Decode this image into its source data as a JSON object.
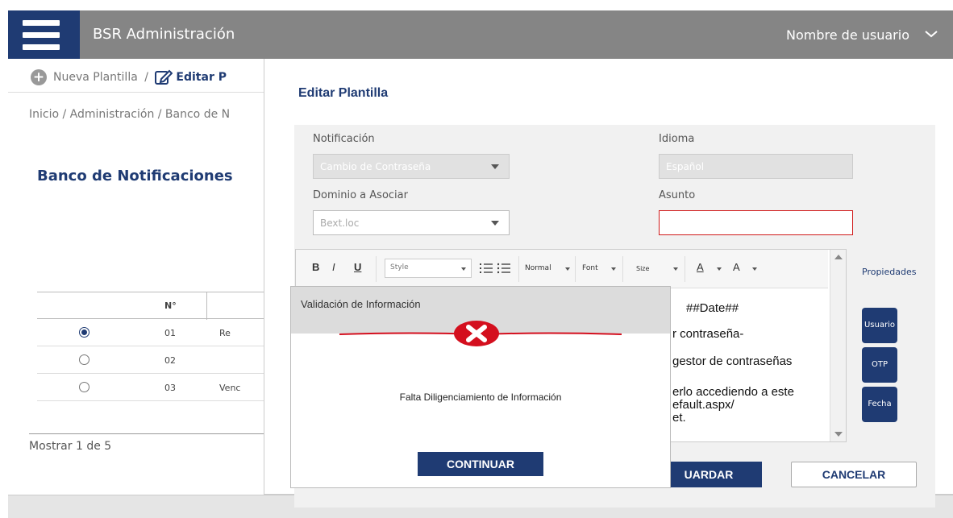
{
  "header": {
    "app_title": "BSR Administración",
    "user_name": "Nombre de usuario"
  },
  "toolbar": {
    "new_template": "Nueva Plantilla",
    "separator": "/",
    "edit_template": "Editar P"
  },
  "breadcrumb": "Inicio  /  Administración  /  Banco de N",
  "page_title": "Banco de Notificaciones",
  "table": {
    "header_n": "N°",
    "rows": [
      {
        "num": "01",
        "name": "Re",
        "selected": true
      },
      {
        "num": "02",
        "name": "",
        "selected": false
      },
      {
        "num": "03",
        "name": "Venc",
        "selected": false
      }
    ]
  },
  "show_count": "Mostrar 1 de 5",
  "edit_panel": {
    "title": "Editar Plantilla",
    "notificacion_label": "Notificación",
    "notificacion_value": "Cambio de Contraseña",
    "idioma_label": "Idioma",
    "idioma_value": "Español",
    "dominio_label": "Dominio a Asociar",
    "dominio_value": "Bext.loc",
    "asunto_label": "Asunto",
    "asunto_value": ""
  },
  "editor": {
    "bold": "B",
    "italic": "I",
    "underline": "U",
    "style_drop": "Style",
    "normal_drop": "Normal",
    "font_drop": "Font",
    "size_drop": "Size",
    "text_color": "A",
    "bg_color": "A",
    "lines": [
      "##Date##",
      "r contraseña-",
      "gestor de contraseñas",
      "erlo accediendo a este",
      "efault.aspx/",
      "et."
    ]
  },
  "side": {
    "properties": "Propiedades",
    "usuario": "Usuario",
    "otp": "OTP",
    "fecha": "Fecha"
  },
  "buttons": {
    "save_partial": "UARDAR",
    "cancel": "CANCELAR"
  },
  "modal": {
    "title": "Validación de Información",
    "message": "Falta Diligenciamiento de Información",
    "continue": "CONTINUAR",
    "error_color": "#d40f1e"
  },
  "colors": {
    "brand": "#1f3b73",
    "topbar": "#858585"
  }
}
